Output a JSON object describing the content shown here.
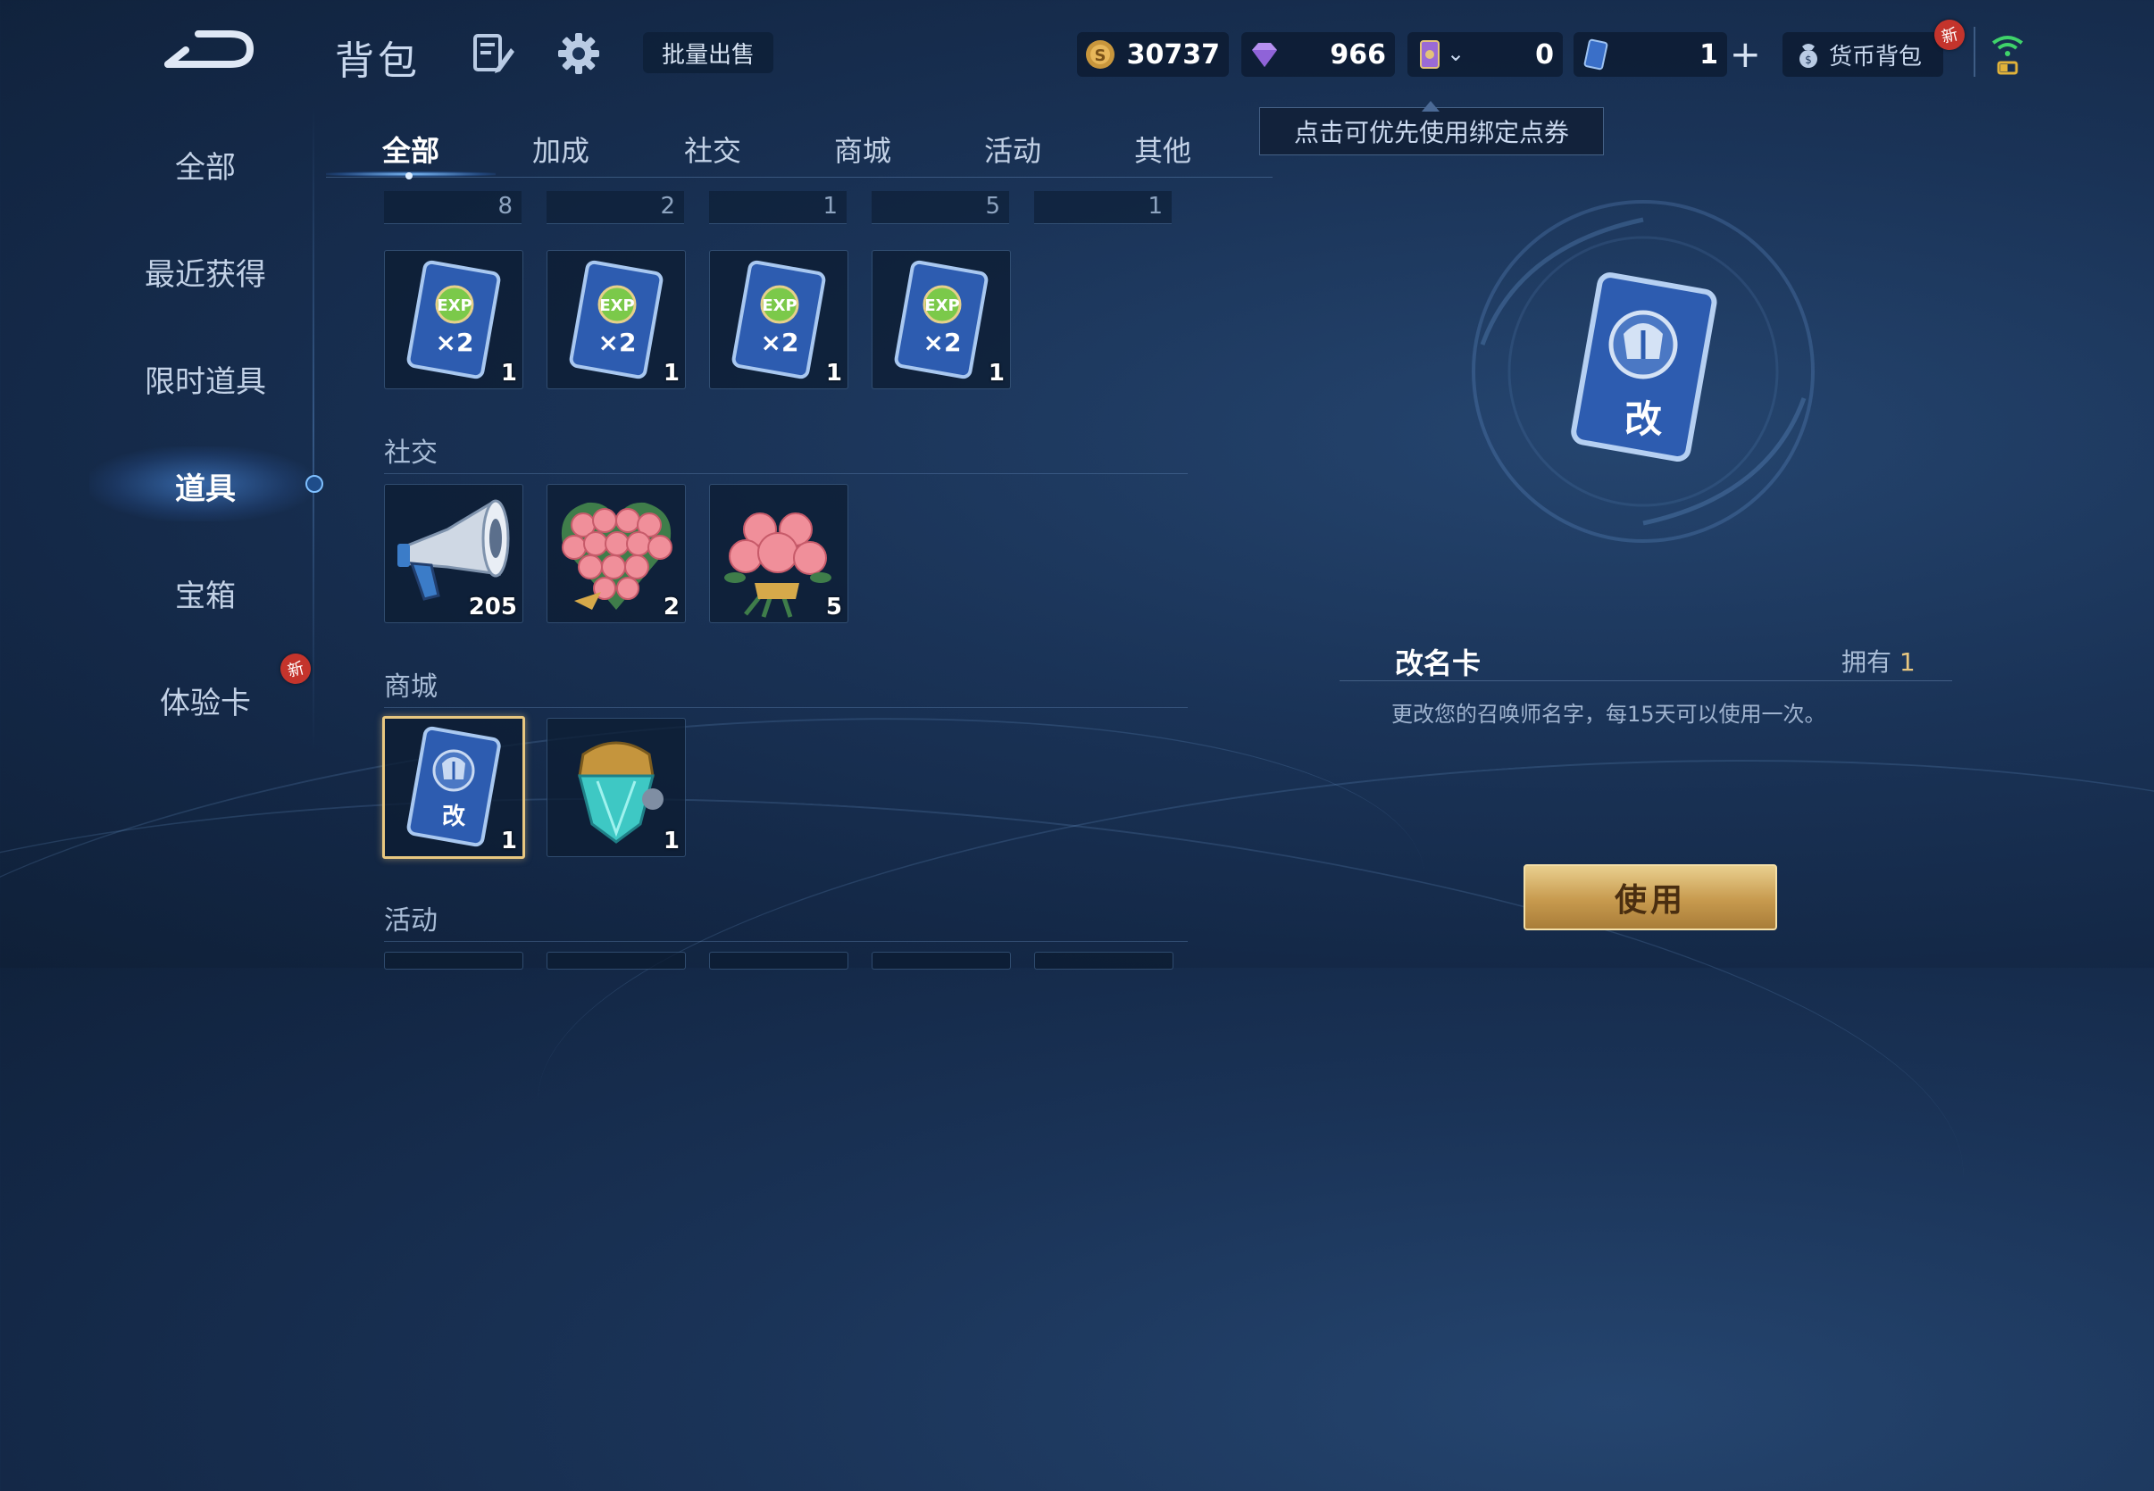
{
  "header": {
    "title": "背包",
    "batch_sell": "批量出售",
    "currencies": [
      {
        "name": "gold-coin",
        "value": "30737"
      },
      {
        "name": "diamond",
        "value": "966"
      },
      {
        "name": "bound-voucher",
        "value": "0"
      },
      {
        "name": "voucher",
        "value": "1"
      }
    ],
    "currency_bag": "货币背包",
    "new_badge": "新"
  },
  "tooltip": "点击可优先使用绑定点券",
  "sidebar": {
    "items": [
      {
        "label": "全部"
      },
      {
        "label": "最近获得"
      },
      {
        "label": "限时道具"
      },
      {
        "label": "道具"
      },
      {
        "label": "宝箱"
      },
      {
        "label": "体验卡"
      }
    ],
    "active_index": 3
  },
  "tabs": [
    "全部",
    "加成",
    "社交",
    "商城",
    "活动",
    "其他"
  ],
  "partial_row_counts": [
    "8",
    "2",
    "1",
    "5",
    "1"
  ],
  "sections": {
    "boost": {
      "items": [
        {
          "icon": "exp-x2-card-icon",
          "count": "1"
        },
        {
          "icon": "exp-x2-card-icon",
          "count": "1"
        },
        {
          "icon": "exp-x2-card-icon",
          "count": "1"
        },
        {
          "icon": "exp-x2-card-icon",
          "count": "1"
        }
      ]
    },
    "social": {
      "label": "社交",
      "items": [
        {
          "icon": "megaphone-icon",
          "count": "205"
        },
        {
          "icon": "rose-heart-bouquet-icon",
          "count": "2"
        },
        {
          "icon": "rose-bouquet-icon",
          "count": "5"
        }
      ]
    },
    "shop": {
      "label": "商城",
      "items": [
        {
          "icon": "rename-card-icon",
          "count": "1",
          "card_text": "改"
        },
        {
          "icon": "crystal-gem-icon",
          "count": "1"
        }
      ]
    },
    "activity": {
      "label": "活动"
    }
  },
  "detail": {
    "name": "改名卡",
    "owned_label": "拥有",
    "owned_count": "1",
    "description": "更改您的召唤师名字，每15天可以使用一次。",
    "card_text": "改",
    "use_button": "使用"
  },
  "colors": {
    "accent_gold": "#e8c780",
    "active_tab": "#ffffff",
    "new_badge": "#c4342c"
  }
}
